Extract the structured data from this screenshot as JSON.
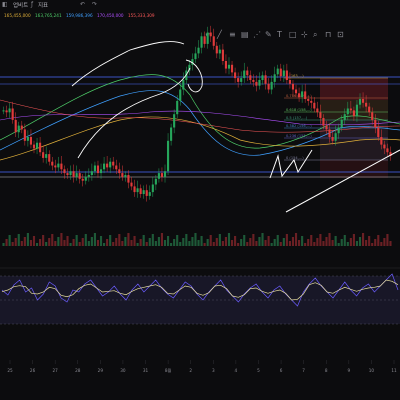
{
  "toolbar": {
    "items": [
      "업비트",
      "지표",
      "이동평균",
      "차트메뉴"
    ],
    "undo_icon": "undo-icon",
    "redo_icon": "redo-icon"
  },
  "indicator_values": [
    {
      "text": "165,455,000",
      "color": "#e0b03a"
    },
    {
      "text": "163,765,241",
      "color": "#4fd06a"
    },
    {
      "text": "159,986,396",
      "color": "#3fa0ff"
    },
    {
      "text": "170,450,000",
      "color": "#b050ff"
    },
    {
      "text": "155,333,309",
      "color": "#ff5a5a"
    }
  ],
  "chart_data": [
    {
      "type": "candlestick",
      "x_tick_labels": [
        "25",
        "26",
        "27",
        "28",
        "29",
        "30",
        "31",
        "8월",
        "2",
        "3",
        "4",
        "5",
        "6",
        "7",
        "8",
        "9",
        "10",
        "11"
      ],
      "fib_levels": [
        {
          "label": "1 (163,...)",
          "color": "#c8a040"
        },
        {
          "label": "0.786 (159,...)",
          "color": "#c06040"
        },
        {
          "label": "0.618 (158,...)",
          "color": "#60c060"
        },
        {
          "label": "0.5 (157,...)",
          "color": "#40a080"
        },
        {
          "label": "0.382 (156,...)",
          "color": "#4080c0"
        },
        {
          "label": "0.236 (155,...)",
          "color": "#6060c0"
        },
        {
          "label": "0 (154,...)",
          "color": "#8080a0"
        }
      ],
      "closes": [
        128,
        126,
        130,
        118,
        105,
        112,
        108,
        96,
        100,
        92,
        88,
        94,
        84,
        78,
        82,
        74,
        70,
        68,
        72,
        66,
        62,
        60,
        64,
        58,
        62,
        56,
        54,
        58,
        60,
        64,
        70,
        62,
        66,
        72,
        68,
        74,
        70,
        66,
        62,
        58,
        60,
        52,
        48,
        42,
        46,
        40,
        44,
        38,
        42,
        50,
        56,
        62,
        58,
        64,
        96,
        110,
        124,
        138,
        150,
        160,
        170,
        176,
        182,
        188,
        194,
        206,
        198,
        210,
        206,
        196,
        188,
        192,
        180,
        172,
        176,
        168,
        162,
        158,
        162,
        170,
        165,
        160,
        158,
        154,
        160,
        165,
        156,
        150,
        158,
        166,
        172,
        164,
        170,
        160,
        156,
        150,
        146,
        142,
        148,
        140,
        138,
        136,
        130,
        126,
        120,
        112,
        108,
        100,
        96,
        104,
        110,
        118,
        124,
        130,
        128,
        122,
        134,
        140,
        136,
        132,
        126,
        118,
        110,
        100,
        92,
        88,
        84,
        80
      ],
      "oscillator": [
        30,
        25,
        35,
        40,
        28,
        32,
        20,
        26,
        38,
        34,
        22,
        18,
        30,
        28,
        36,
        40,
        32,
        24,
        28,
        34,
        26,
        20,
        30,
        36,
        28,
        34,
        40,
        32,
        26,
        22,
        30,
        38,
        34,
        26,
        20,
        28,
        34,
        40,
        30,
        24,
        18,
        26,
        32,
        36,
        28,
        22,
        30,
        34,
        26,
        20,
        14,
        28,
        36,
        42,
        34,
        28,
        22,
        30,
        38,
        30,
        24,
        32,
        36,
        28,
        34,
        40,
        46,
        30
      ]
    }
  ]
}
